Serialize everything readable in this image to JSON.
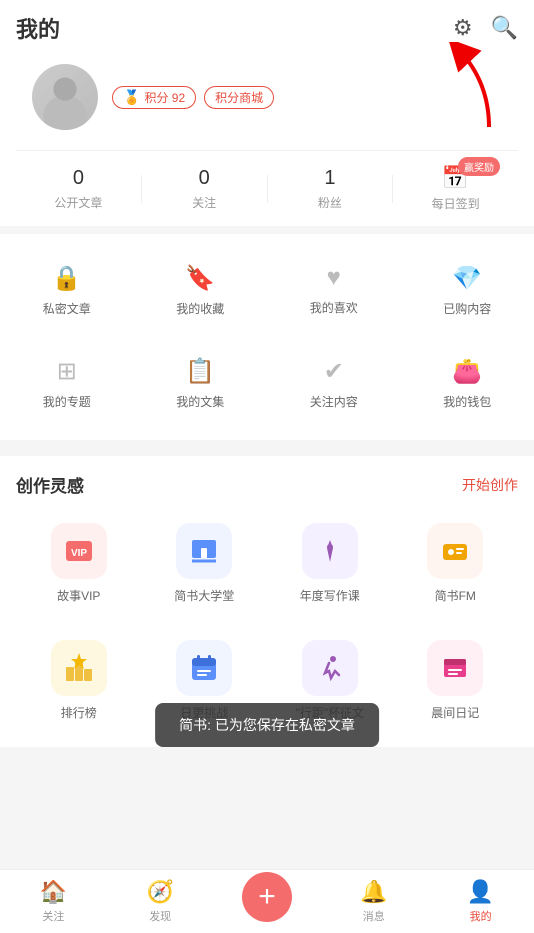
{
  "header": {
    "title": "我的",
    "settings_label": "设置",
    "search_label": "搜索"
  },
  "profile": {
    "points": "积分 92",
    "points_shop": "积分商城"
  },
  "stats": [
    {
      "value": "0",
      "label": "公开文章"
    },
    {
      "value": "0",
      "label": "关注"
    },
    {
      "value": "1",
      "label": "粉丝"
    }
  ],
  "checkin": {
    "badge": "赢奖励",
    "label": "每日签到"
  },
  "menu_row1": [
    {
      "icon": "🔒",
      "label": "私密文章"
    },
    {
      "icon": "🔖",
      "label": "我的收藏"
    },
    {
      "icon": "♥",
      "label": "我的喜欢"
    },
    {
      "icon": "💎",
      "label": "已购内容"
    }
  ],
  "menu_row2": [
    {
      "icon": "⊞",
      "label": "我的专题"
    },
    {
      "icon": "📋",
      "label": "我的文集"
    },
    {
      "icon": "✔",
      "label": "关注内容"
    },
    {
      "icon": "👛",
      "label": "我的钱包"
    }
  ],
  "creation": {
    "title": "创作灵感",
    "action": "开始创作"
  },
  "apps_row1": [
    {
      "icon_class": "app-icon-vip",
      "emoji": "📕",
      "label": "故事VIP"
    },
    {
      "icon_class": "app-icon-university",
      "emoji": "🖥",
      "label": "简书大学堂"
    },
    {
      "icon_class": "app-icon-writing",
      "emoji": "✒",
      "label": "年度写作课"
    },
    {
      "icon_class": "app-icon-fm",
      "emoji": "📻",
      "label": "简书FM"
    }
  ],
  "apps_row2": [
    {
      "icon_class": "app-icon-rank",
      "emoji": "🏆",
      "label": "排行榜"
    },
    {
      "icon_class": "app-icon-daily",
      "emoji": "📅",
      "label": "日更挑战"
    },
    {
      "icon_class": "app-icon-running",
      "emoji": "🏃",
      "label": "\"行距\"杯征文"
    },
    {
      "icon_class": "app-icon-morning",
      "emoji": "📦",
      "label": "晨间日记"
    }
  ],
  "toast": {
    "message": "简书: 已为您保存在私密文章"
  },
  "bottom_nav": [
    {
      "icon": "🏠",
      "label": "关注",
      "active": false
    },
    {
      "icon": "🧭",
      "label": "发现",
      "active": false
    },
    {
      "icon": "+",
      "label": "",
      "is_add": true
    },
    {
      "icon": "🔔",
      "label": "消息",
      "active": false
    },
    {
      "icon": "👤",
      "label": "我的",
      "active": true
    }
  ]
}
